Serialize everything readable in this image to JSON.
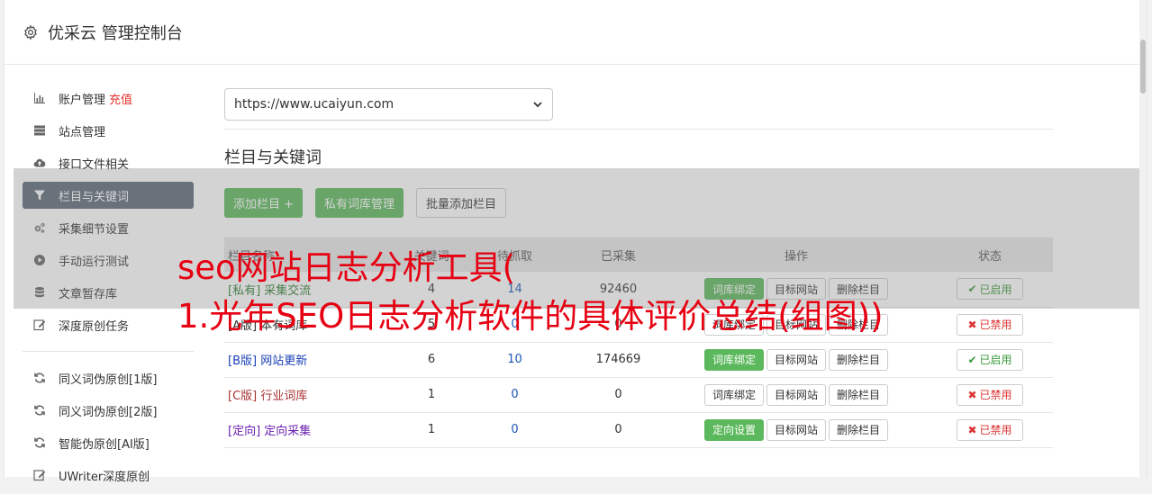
{
  "header": {
    "title": "优采云 管理控制台",
    "icon": "gear-icon"
  },
  "sidebar": {
    "items": [
      {
        "label": "账户管理",
        "extra": "充值",
        "icon": "bar-chart-icon"
      },
      {
        "label": "站点管理",
        "icon": "server-icon"
      },
      {
        "label": "接口文件相关",
        "icon": "cloud-upload-icon"
      },
      {
        "label": "栏目与关键词",
        "icon": "filter-icon",
        "active": true
      },
      {
        "label": "采集细节设置",
        "icon": "cogs-icon"
      },
      {
        "label": "手动运行测试",
        "icon": "play-circle-icon"
      },
      {
        "label": "文章暂存库",
        "icon": "database-icon"
      },
      {
        "label": "深度原创任务",
        "icon": "edit-icon"
      },
      {
        "label": "同义词伪原创[1版]",
        "icon": "refresh-icon"
      },
      {
        "label": "同义词伪原创[2版]",
        "icon": "refresh-icon"
      },
      {
        "label": "智能伪原创[AI版]",
        "icon": "refresh-icon"
      },
      {
        "label": "UWriter深度原创",
        "icon": "edit-icon"
      }
    ]
  },
  "main": {
    "site_select": "https://www.ucaiyun.com",
    "section_title": "栏目与关键词",
    "buttons": {
      "add": "添加栏目 +",
      "private": "私有词库管理",
      "batch": "批量添加栏目"
    },
    "columns": [
      "栏目名称",
      "关键词",
      "待抓取",
      "已采集",
      "操作",
      "状态"
    ],
    "rows": [
      {
        "tag": "[私有]",
        "name": "采集交流",
        "keywords": "4",
        "pending": "14",
        "collected": "92460",
        "op1": "词库绑定",
        "op1_green": true,
        "op2": "目标网站",
        "op3": "删除栏目",
        "status": "已启用",
        "enabled": true,
        "color": "#2e7d32"
      },
      {
        "tag": "[A版]",
        "name": "本有词库",
        "keywords": "5",
        "pending": "0",
        "collected": "0",
        "op1": "词库绑定",
        "op1_green": false,
        "op2": "目标网站",
        "op3": "删除栏目",
        "status": "已禁用",
        "enabled": false,
        "color": "#333333"
      },
      {
        "tag": "[B版]",
        "name": "网站更新",
        "keywords": "6",
        "pending": "10",
        "collected": "174669",
        "op1": "词库绑定",
        "op1_green": true,
        "op2": "目标网站",
        "op3": "删除栏目",
        "status": "已启用",
        "enabled": true,
        "color": "#1a3fb5"
      },
      {
        "tag": "[C版]",
        "name": "行业词库",
        "keywords": "1",
        "pending": "0",
        "collected": "0",
        "op1": "词库绑定",
        "op1_green": false,
        "op2": "目标网站",
        "op3": "删除栏目",
        "status": "已禁用",
        "enabled": false,
        "color": "#a83232"
      },
      {
        "tag": "[定向]",
        "name": "定向采集",
        "keywords": "1",
        "pending": "0",
        "collected": "0",
        "op1": "定向设置",
        "op1_green": true,
        "op2": "目标网站",
        "op3": "删除栏目",
        "status": "已禁用",
        "enabled": false,
        "color": "#6a1fb0"
      }
    ]
  },
  "overlay": {
    "line1": "seo网站日志分析工具(",
    "line2": "1.光年SEO日志分析软件的具体评价总结(组图))"
  },
  "colors": {
    "accent_green": "#5cb85c",
    "active_nav": "#5c6a79",
    "overlay_text": "#e60012"
  }
}
